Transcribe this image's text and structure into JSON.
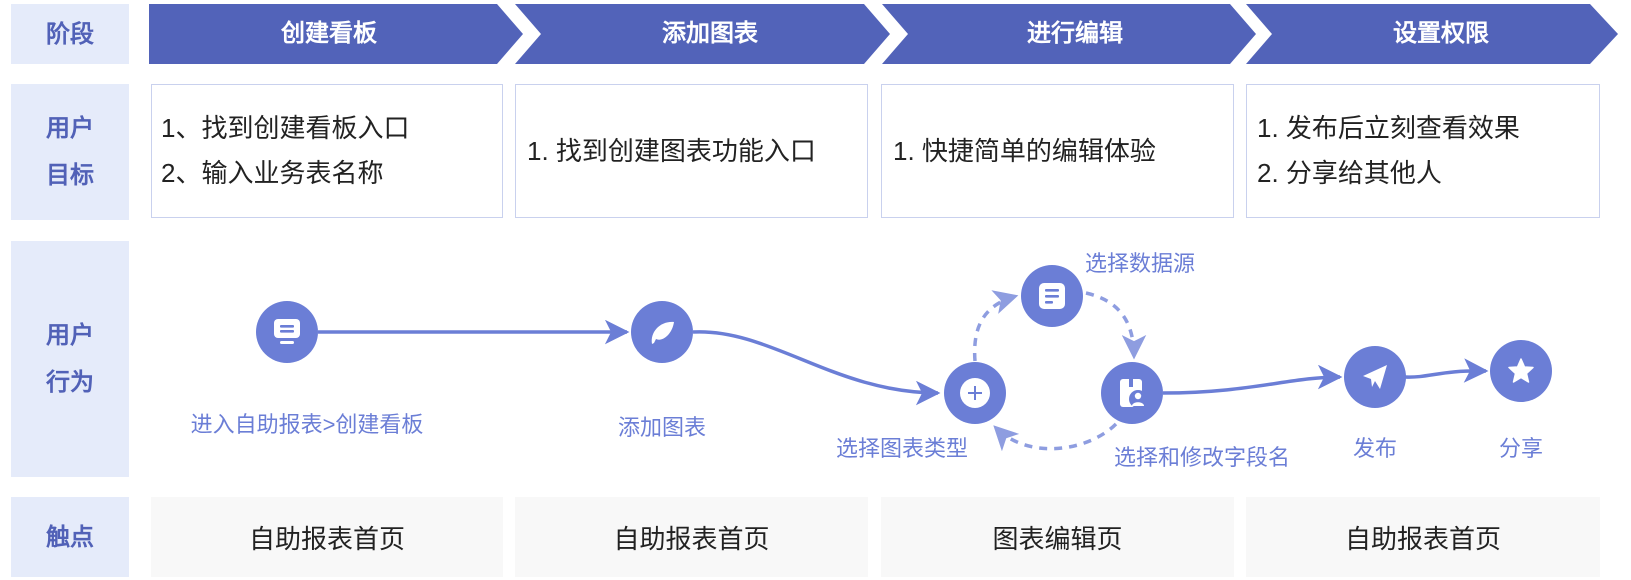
{
  "colors": {
    "stage_fill": "#5263b9",
    "label_bg": "#e5ebfa",
    "label_text": "#5161b7",
    "node_fill": "#6b7ed6",
    "dashed_edge": "#8e9de0",
    "card_border": "#c9d1ee",
    "touch_bg": "#f8f8f8"
  },
  "stage_row": {
    "label": "阶段",
    "stages": [
      "创建看板",
      "添加图表",
      "进行编辑",
      "设置权限"
    ]
  },
  "goal_row": {
    "label_lines": [
      "用户",
      "目标"
    ],
    "cards": [
      {
        "lines": [
          "1、找到创建看板入口",
          "2、输入业务表名称"
        ]
      },
      {
        "lines": [
          "1. 找到创建图表功能入口"
        ]
      },
      {
        "lines": [
          "1. 快捷简单的编辑体验"
        ]
      },
      {
        "lines": [
          "1. 发布后立刻查看效果",
          "2. 分享给其他人"
        ]
      }
    ]
  },
  "behavior_row": {
    "label_lines": [
      "用户",
      "行为"
    ],
    "nodes": [
      {
        "label": "进入自助报表>创建看板",
        "icon": "monitor-icon"
      },
      {
        "label": "添加图表",
        "icon": "leaf-icon"
      },
      {
        "label": "选择图表类型",
        "icon": "plus-circle-icon"
      },
      {
        "label": "选择数据源",
        "icon": "document-icon"
      },
      {
        "label": "选择和修改字段名",
        "icon": "field-edit-icon"
      },
      {
        "label": "发布",
        "icon": "send-icon"
      },
      {
        "label": "分享",
        "icon": "star-icon"
      }
    ],
    "edges": [
      {
        "from": 0,
        "to": 1,
        "style": "solid"
      },
      {
        "from": 1,
        "to": 2,
        "style": "solid"
      },
      {
        "from": 2,
        "to": 3,
        "style": "dashed"
      },
      {
        "from": 3,
        "to": 4,
        "style": "dashed"
      },
      {
        "from": 4,
        "to": 2,
        "style": "dashed"
      },
      {
        "from": 4,
        "to": 5,
        "style": "solid"
      },
      {
        "from": 5,
        "to": 6,
        "style": "solid"
      }
    ]
  },
  "touchpoint_row": {
    "label": "触点",
    "cards": [
      "自助报表首页",
      "自助报表首页",
      "图表编辑页",
      "自助报表首页"
    ]
  }
}
